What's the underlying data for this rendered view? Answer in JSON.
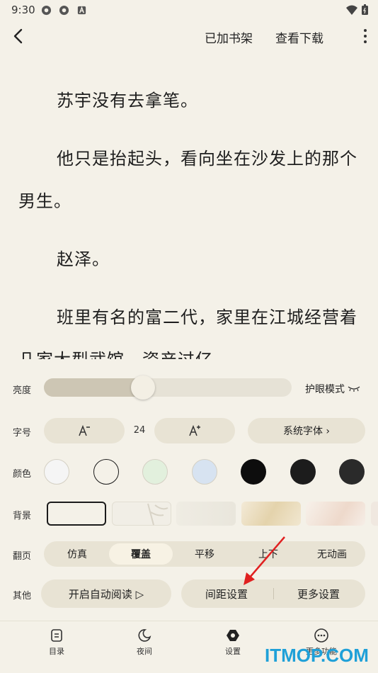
{
  "status_bar": {
    "time": "9:30"
  },
  "top_bar": {
    "bookshelf_label": "已加书架",
    "download_label": "查看下载"
  },
  "content": {
    "paragraphs": [
      "苏宇没有去拿笔。",
      "他只是抬起头，看向坐在沙发上的那个男生。",
      "赵泽。",
      "班里有名的富二代，家里在江城经营着几家大型武馆，资产过亿"
    ]
  },
  "settings": {
    "brightness": {
      "label": "亮度",
      "level": 0.4,
      "eye_mode_label": "护眼模式"
    },
    "font": {
      "label": "字号",
      "size_value": "24",
      "font_family_label": "系统字体 ›"
    },
    "color": {
      "label": "颜色",
      "options": [
        "#f5f5f5",
        "#f4f1e8",
        "#e2f0dd",
        "#d7e3f1",
        "#0d0d0d",
        "#1c1c1c",
        "#2a2a2a"
      ],
      "selected_index": 1
    },
    "background": {
      "label": "背景",
      "selected_index": 0
    },
    "page_turn": {
      "label": "翻页",
      "options": [
        "仿真",
        "覆盖",
        "平移",
        "上下",
        "无动画"
      ],
      "selected": "覆盖"
    },
    "other": {
      "label": "其他",
      "auto_read_label": "开启自动阅读 ▷",
      "spacing_label": "间距设置",
      "more_label": "更多设置"
    }
  },
  "bottom_nav": {
    "items": [
      "目录",
      "夜间",
      "设置",
      "更多功能"
    ]
  },
  "watermark": "ITMOP.COM"
}
